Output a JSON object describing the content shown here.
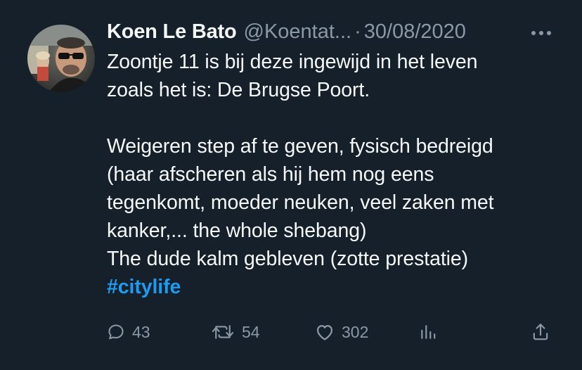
{
  "tweet": {
    "author_name": "Koen Le Bato",
    "author_handle": "@Koentat...",
    "separator": "·",
    "date": "30/08/2020",
    "body_lines": [
      "Zoontje 11 is bij deze ingewijd in het leven",
      "zoals het is: De Brugse Poort.",
      "",
      "Weigeren step af te geven, fysisch bedreigd",
      "(haar afscheren als hij hem nog eens",
      "tegenkomt, moeder neuken, veel zaken met",
      "kanker,... the whole shebang)",
      "The dude kalm gebleven (zotte prestatie)"
    ],
    "hashtag": "#citylife"
  },
  "actions": {
    "replies": "43",
    "retweets": "54",
    "likes": "302"
  },
  "icons": {
    "more": "more-horizontal-icon",
    "reply": "reply-icon",
    "retweet": "retweet-icon",
    "like": "heart-icon",
    "views": "analytics-icon",
    "share": "share-icon"
  },
  "colors": {
    "background": "#15202b",
    "text": "#f7f9f9",
    "secondary": "#8b98a5",
    "accent": "#1d9bf0"
  }
}
